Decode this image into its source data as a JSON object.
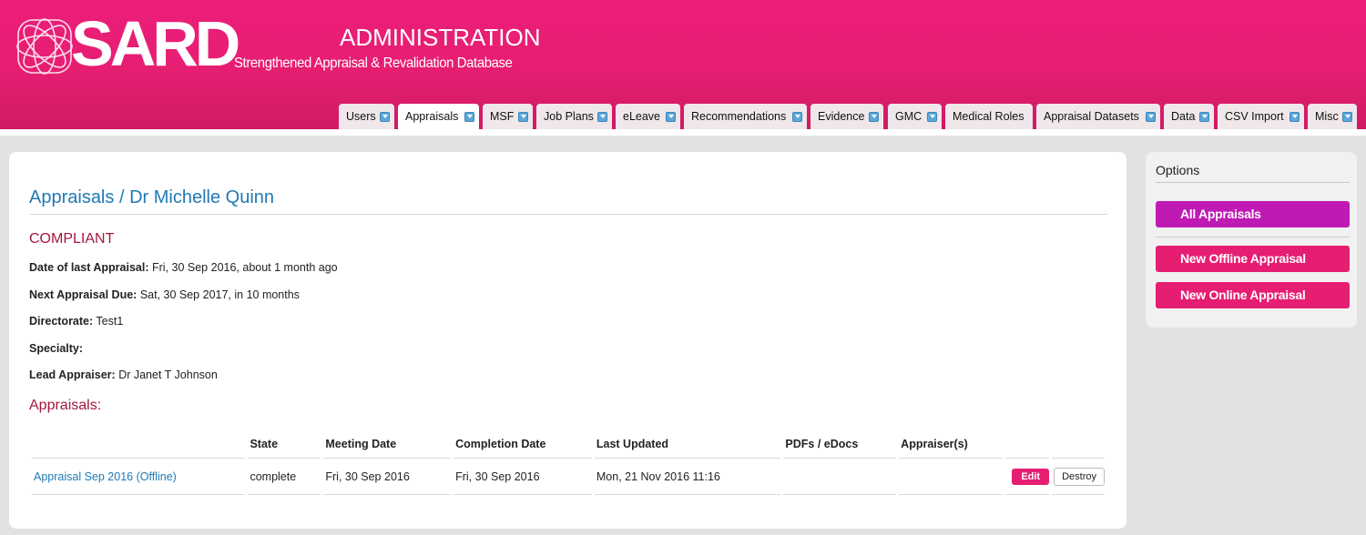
{
  "header": {
    "logo_text": "SARD",
    "title": "ADMINISTRATION",
    "subtitle": "Strengthened Appraisal & Revalidation Database"
  },
  "nav": {
    "tabs": [
      {
        "label": "Users"
      },
      {
        "label": "Appraisals"
      },
      {
        "label": "MSF"
      },
      {
        "label": "Job Plans"
      },
      {
        "label": "eLeave"
      },
      {
        "label": "Recommendations"
      },
      {
        "label": "Evidence"
      },
      {
        "label": "GMC"
      },
      {
        "label": "Medical Roles"
      },
      {
        "label": "Appraisal Datasets"
      },
      {
        "label": "Data"
      },
      {
        "label": "CSV Import"
      },
      {
        "label": "Misc"
      }
    ],
    "active": "Appraisals"
  },
  "main": {
    "breadcrumb": {
      "section": "Appraisals",
      "separator": "/",
      "person": "Dr Michelle Quinn"
    },
    "status": "COMPLIANT",
    "fields": [
      {
        "label": "Date of last Appraisal:",
        "value": "Fri, 30 Sep 2016, about 1 month ago"
      },
      {
        "label": "Next Appraisal Due:",
        "value": "Sat, 30 Sep 2017, in 10 months"
      },
      {
        "label": "Directorate:",
        "value": "Test1"
      },
      {
        "label": "Specialty:",
        "value": ""
      },
      {
        "label": "Lead Appraiser:",
        "value": "Dr Janet T Johnson"
      }
    ],
    "appraisals_title": "Appraisals:",
    "table": {
      "headers": [
        "",
        "State",
        "Meeting Date",
        "Completion Date",
        "Last Updated",
        "PDFs / eDocs",
        "Appraiser(s)",
        "",
        ""
      ],
      "rows": [
        {
          "name": "Appraisal Sep 2016 (Offline)",
          "state": "complete",
          "meeting_date": "Fri, 30 Sep 2016",
          "completion_date": "Fri, 30 Sep 2016",
          "last_updated": "Mon, 21 Nov 2016 11:16",
          "pdfs": "",
          "appraisers": "",
          "edit_label": "Edit",
          "destroy_label": "Destroy"
        }
      ]
    }
  },
  "options": {
    "title": "Options",
    "buttons": [
      {
        "label": "All Appraisals",
        "color": "#c01ab5"
      },
      {
        "label": "New Offline Appraisal",
        "color": "#e61e72"
      },
      {
        "label": "New Online Appraisal",
        "color": "#e61e72"
      }
    ]
  },
  "colors": {
    "brand": "#e61e72",
    "link": "#1f7ab5",
    "heading_red": "#a3173f",
    "purple_button": "#c01ab5"
  }
}
